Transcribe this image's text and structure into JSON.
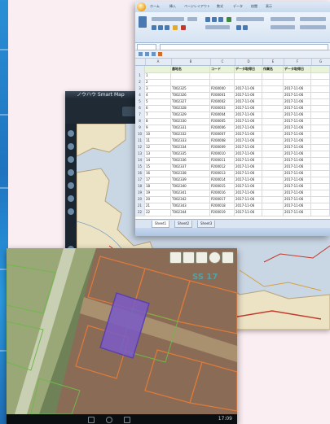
{
  "colors": {
    "page_background": "#fbeef2",
    "accent_strip": "#2a8fd6",
    "map_chrome": "#1f2a35",
    "spreadsheet_header_row": "#e9f3d8",
    "parcel_selected": "#7a5bc8"
  },
  "map_window": {
    "title": "ノウハウ Smart Map"
  },
  "spreadsheet": {
    "ribbon_tabs": [
      "ホーム",
      "挿入",
      "ページレイアウト",
      "数式",
      "データ",
      "校閲",
      "表示"
    ],
    "column_letters": [
      "A",
      "B",
      "C",
      "D",
      "E",
      "F",
      "G"
    ],
    "header_row": [
      "農地名",
      "コード",
      "データ取得日",
      "作業名",
      "データ取得日"
    ],
    "rows": [
      [
        "1",
        "",
        "",
        "",
        "",
        "",
        ""
      ],
      [
        "2",
        "",
        "",
        "",
        "",
        "",
        ""
      ],
      [
        "3",
        "T002325",
        "P200000",
        "2017-11-06",
        "",
        "2017-11-06",
        ""
      ],
      [
        "4",
        "T002326",
        "P200001",
        "2017-11-06",
        "",
        "2017-11-06",
        ""
      ],
      [
        "5",
        "T002327",
        "P200002",
        "2017-11-06",
        "",
        "2017-11-06",
        ""
      ],
      [
        "6",
        "T002328",
        "P200003",
        "2017-11-06",
        "",
        "2017-11-06",
        ""
      ],
      [
        "7",
        "T002329",
        "P200004",
        "2017-11-06",
        "",
        "2017-11-06",
        ""
      ],
      [
        "8",
        "T002330",
        "P200005",
        "2017-11-06",
        "",
        "2017-11-06",
        ""
      ],
      [
        "9",
        "T002331",
        "P200006",
        "2017-11-06",
        "",
        "2017-11-06",
        ""
      ],
      [
        "10",
        "T002332",
        "P200007",
        "2017-11-06",
        "",
        "2017-11-06",
        ""
      ],
      [
        "11",
        "T002333",
        "P200008",
        "2017-11-06",
        "",
        "2017-11-06",
        ""
      ],
      [
        "12",
        "T002334",
        "P200009",
        "2017-11-06",
        "",
        "2017-11-06",
        ""
      ],
      [
        "13",
        "T002335",
        "P200010",
        "2017-11-06",
        "",
        "2017-11-06",
        ""
      ],
      [
        "14",
        "T002336",
        "P200011",
        "2017-11-06",
        "",
        "2017-11-06",
        ""
      ],
      [
        "15",
        "T002337",
        "P200012",
        "2017-11-06",
        "",
        "2017-11-06",
        ""
      ],
      [
        "16",
        "T002338",
        "P200013",
        "2017-11-06",
        "",
        "2017-11-06",
        ""
      ],
      [
        "17",
        "T002339",
        "P200014",
        "2017-11-06",
        "",
        "2017-11-06",
        ""
      ],
      [
        "18",
        "T002340",
        "P200015",
        "2017-11-06",
        "",
        "2017-11-06",
        ""
      ],
      [
        "19",
        "T002341",
        "P200016",
        "2017-11-06",
        "",
        "2017-11-06",
        ""
      ],
      [
        "20",
        "T002342",
        "P200017",
        "2017-11-06",
        "",
        "2017-11-06",
        ""
      ],
      [
        "21",
        "T002343",
        "P200018",
        "2017-11-06",
        "",
        "2017-11-06",
        ""
      ],
      [
        "22",
        "T002344",
        "P200019",
        "2017-11-06",
        "",
        "2017-11-06",
        ""
      ]
    ],
    "sheet_tabs": [
      "Sheet1",
      "Sheet2",
      "Sheet3"
    ]
  },
  "tablet": {
    "overlay_label": "SS 17",
    "clock": "17:09"
  }
}
